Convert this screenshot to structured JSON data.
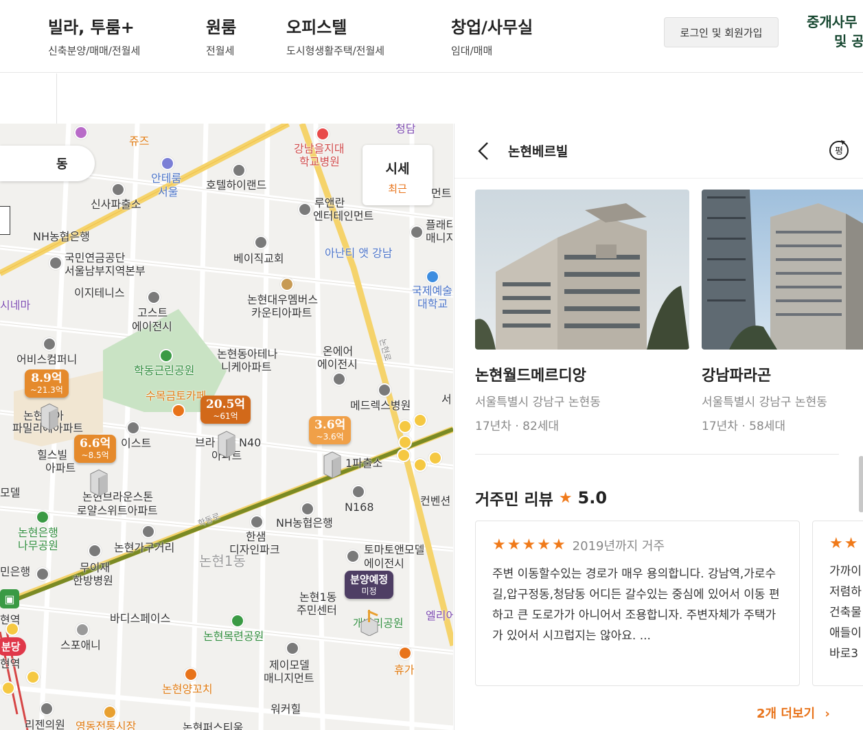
{
  "nav": {
    "items": [
      {
        "title": "빌라, 투룸+",
        "sub": "신축분양/매매/전월세"
      },
      {
        "title": "원룸",
        "sub": "전월세"
      },
      {
        "title": "오피스텔",
        "sub": "도시형생활주택/전월세"
      },
      {
        "title": "창업/사무실",
        "sub": "임대/매매"
      }
    ],
    "login": "로그인 및 회원가입",
    "broker_line1": "중개사무",
    "broker_line2": "및 공"
  },
  "map": {
    "region_chip": "동",
    "sise": {
      "title": "시세",
      "sub": "최근"
    },
    "dong_label": "논현1동",
    "road_label": "학동로",
    "road_label2": "논현로",
    "pois": {
      "p1": "신사파출소",
      "p2": "NH농협은행",
      "p3": "국민연금공단",
      "p4": "서울남부지역본부",
      "p5": "이지테니스",
      "p6": "고스트",
      "p7": "에이전시",
      "p8": "어비스컴퍼니",
      "p9": "학동근린공원",
      "p10": "수목금토카페",
      "p11": "논현동아테나",
      "p12": "니케아파트",
      "p13": "온에어",
      "p14": "에이전시",
      "p15": "메드렉스병원",
      "p16": "베이직교회",
      "p17": "논현대우멤버스",
      "p18": "카운티아파트",
      "p19": "아난티 앳 강남",
      "p20": "루앤란",
      "p21": "엔터테인먼트",
      "p22": "호텔하이랜드",
      "p23": "안테룸",
      "p24": "서울",
      "p25": "강남을지대",
      "p26": "학교병원",
      "p27": "쥬즈",
      "p28": "청담",
      "p29": "국제예술",
      "p30": "대학교",
      "p31": "플래티",
      "p32": "매니지",
      "p33": "먼트",
      "p34": "시네마",
      "p35": "논현동아",
      "p36": "파밀리에아파트",
      "p37": "힐스빌",
      "p38": "아파트",
      "p39": "이스트",
      "p40": "브라",
      "p41": "N40",
      "p42": "아파트",
      "p43": "1파출소",
      "p44": "논현브라운스톤",
      "p45": "로얄스위트아파트",
      "p46": "모델",
      "p47": "N168",
      "p48": "NH농협은행",
      "p49": "컨벤션",
      "p50": "논현은행",
      "p51": "나무공원",
      "p52": "논현가구거리",
      "p53": "한샘",
      "p54": "디자인파크",
      "p55": "토마토앤모델",
      "p56": "에이전시",
      "p57": "민은행",
      "p58": "무이재",
      "p59": "한방병원",
      "p60": "논현1동",
      "p61": "주민센터",
      "p62": "바디스페이스",
      "p63": "스포애니",
      "p64": "논현목련공원",
      "p65": "제이모델",
      "p66": "매니지먼트",
      "p67": "휴가",
      "p68": "논현양꼬치",
      "p69": "워커힐",
      "p70": "리젠의원",
      "p71": "영동전통시장",
      "p72": "논현퍼스티움",
      "p73": "엘리어",
      "p74": "개나리공원",
      "p75": "서",
      "p76": "현역",
      "p77": "분당",
      "p78": "현역"
    },
    "tags": [
      {
        "main": "8.9억",
        "sub": "~21.3억",
        "color": "#e58a2c"
      },
      {
        "main": "20.5억",
        "sub": "~61억",
        "color": "#d2691a"
      },
      {
        "main": "3.6억",
        "sub": "~3.6억",
        "color": "#f0a048"
      },
      {
        "main": "6.6억",
        "sub": "~8.5억",
        "color": "#e58a2c"
      }
    ],
    "presale": {
      "main": "분양예정",
      "sub": "미정",
      "color": "#4e3e64"
    }
  },
  "detail": {
    "title": "논현베르빌",
    "cards": [
      {
        "name": "논현월드메르디앙",
        "addr": "서울특별시 강남구 논현동",
        "meta": "17년차 · 82세대"
      },
      {
        "name": "강남파라곤",
        "addr": "서울특별시 강남구 논현동",
        "meta": "17년차 · 58세대"
      }
    ],
    "review_title": "거주민 리뷰",
    "review_score": "5.0",
    "reviews": [
      {
        "period": "2019년까지 거주",
        "text": "주변 이동할수있는 경로가 매우 용의합니다. 강남역,가로수길,압구정동,청담동 어디든 갈수있는 중심에 있어서 이동 편하고 큰 도로가가 아니어서 조용합니자. 주변자체가 주택가가 있어서 시끄럽지는 않아요. ..."
      },
      {
        "period": "",
        "text": "가까이 저렴하 건축물 애들이 바로3"
      }
    ],
    "more": "2개 더보기"
  },
  "colors": {
    "accent": "#e8731a",
    "brand_dark": "#15462f",
    "road_yellow": "#f5d36b",
    "subway_green": "#7a8a24"
  }
}
